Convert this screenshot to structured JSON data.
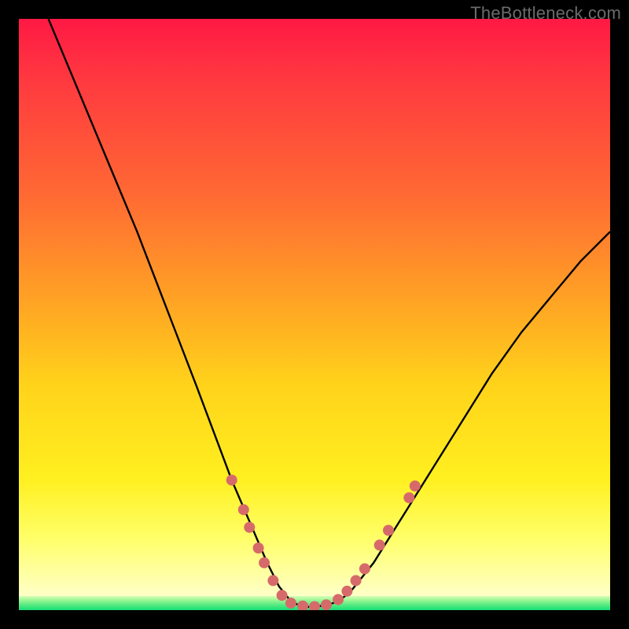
{
  "watermark": "TheBottleneck.com",
  "colors": {
    "page_bg": "#000000",
    "curve": "#000000",
    "marker_fill": "#d66a6a",
    "gradient": [
      "#ff1944",
      "#ff6a33",
      "#ffa424",
      "#ffd31a",
      "#fff020",
      "#ffffe0"
    ],
    "green_band": [
      "#d8ffb5",
      "#90f590",
      "#48e87e",
      "#18dc78"
    ]
  },
  "chart_data": {
    "type": "line",
    "title": "",
    "xlabel": "",
    "ylabel": "",
    "xlim": [
      0,
      100
    ],
    "ylim": [
      0,
      100
    ],
    "grid": false,
    "legend": false,
    "series": [
      {
        "name": "bottleneck-curve-left",
        "x": [
          5,
          10,
          15,
          20,
          25,
          30,
          33,
          36,
          39,
          42,
          44,
          46,
          48
        ],
        "y": [
          100,
          88,
          76,
          64,
          51,
          38,
          30,
          22,
          15,
          8,
          4,
          1.5,
          0.5
        ]
      },
      {
        "name": "bottleneck-curve-right",
        "x": [
          48,
          50,
          52,
          54,
          56,
          60,
          65,
          70,
          75,
          80,
          85,
          90,
          95,
          100
        ],
        "y": [
          0.5,
          0.6,
          0.8,
          1.5,
          3,
          8,
          16,
          24,
          32,
          40,
          47,
          53,
          59,
          64
        ]
      }
    ],
    "markers": {
      "name": "highlighted-points",
      "points": [
        {
          "x": 36,
          "y": 22
        },
        {
          "x": 38,
          "y": 17
        },
        {
          "x": 39,
          "y": 14
        },
        {
          "x": 40.5,
          "y": 10.5
        },
        {
          "x": 41.5,
          "y": 8
        },
        {
          "x": 43,
          "y": 5
        },
        {
          "x": 44.5,
          "y": 2.5
        },
        {
          "x": 46,
          "y": 1.2
        },
        {
          "x": 48,
          "y": 0.7
        },
        {
          "x": 50,
          "y": 0.6
        },
        {
          "x": 52,
          "y": 0.9
        },
        {
          "x": 54,
          "y": 1.8
        },
        {
          "x": 55.5,
          "y": 3.2
        },
        {
          "x": 57,
          "y": 5
        },
        {
          "x": 58.5,
          "y": 7
        },
        {
          "x": 61,
          "y": 11
        },
        {
          "x": 62.5,
          "y": 13.5
        },
        {
          "x": 66,
          "y": 19
        },
        {
          "x": 67,
          "y": 21
        }
      ]
    }
  }
}
